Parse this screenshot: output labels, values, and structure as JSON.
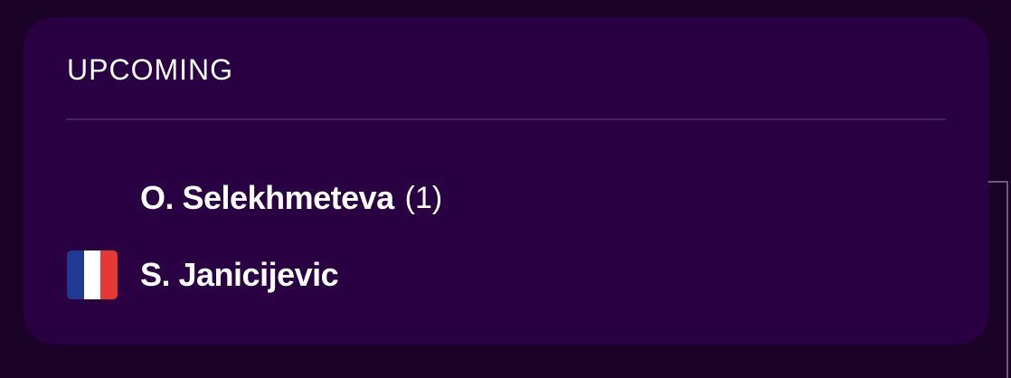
{
  "card": {
    "title": "UPCOMING"
  },
  "players": [
    {
      "name": "O. Selekhmeteva",
      "seed": "(1)",
      "flag_icon": null
    },
    {
      "name": "S. Janicijevic",
      "seed": "",
      "flag_icon": "france-flag-icon"
    }
  ],
  "colors": {
    "page_background": "#1a0326",
    "card_background": "#290042",
    "divider": "#45225a",
    "bracket_line": "#6e5a7c",
    "text": "#ffffff",
    "flag_blue": "#1f3a93",
    "flag_white": "#ffffff",
    "flag_red": "#e53935"
  }
}
